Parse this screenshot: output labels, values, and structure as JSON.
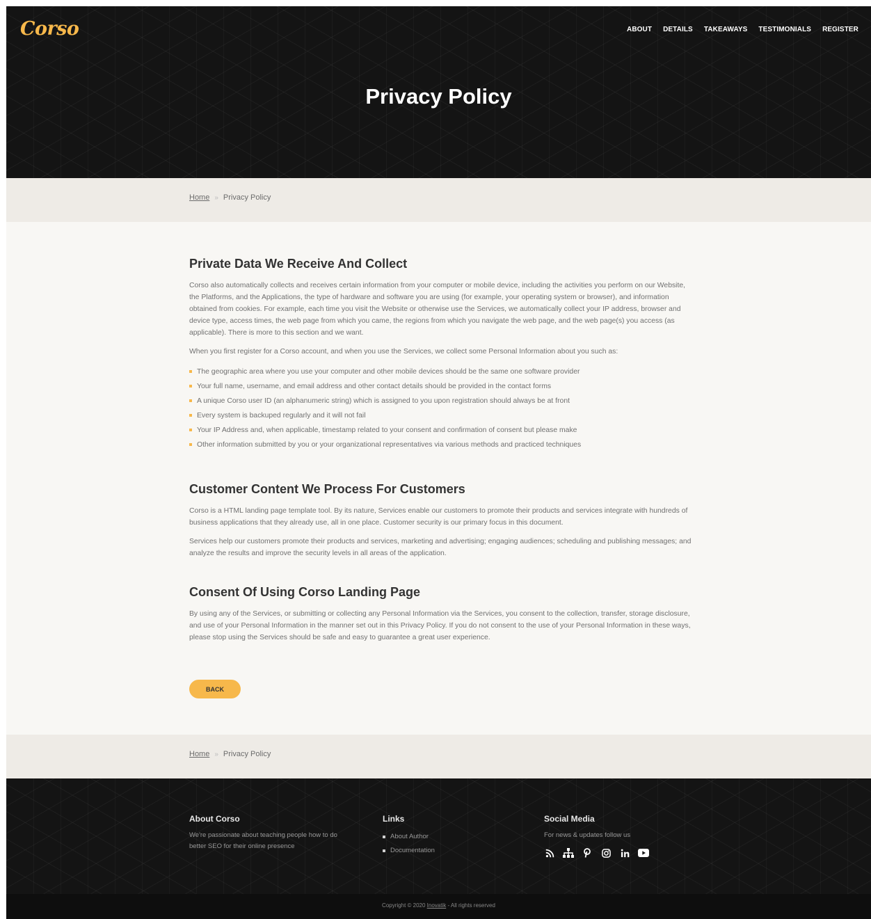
{
  "header": {
    "logo": "Corso",
    "nav": [
      "ABOUT",
      "DETAILS",
      "TAKEAWAYS",
      "TESTIMONIALS",
      "REGISTER"
    ],
    "title": "Privacy Policy"
  },
  "breadcrumb": {
    "home": "Home",
    "separator": "»",
    "current": "Privacy Policy"
  },
  "section1": {
    "heading": "Private Data We Receive And Collect",
    "para1": "Corso also automatically collects and receives certain information from your computer or mobile device, including the activities you perform on our Website, the Platforms, and the Applications, the type of hardware and software you are using (for example, your operating system or browser), and information obtained from cookies. For example, each time you visit the Website or otherwise use the Services, we automatically collect your IP address, browser and device type, access times, the web page from which you came, the regions from which you navigate the web page, and the web page(s) you access (as applicable). There is more to this section and we want.",
    "para2": "When you first register for a Corso account, and when you use the Services, we collect some Personal Information about you such as:",
    "bullets": [
      "The geographic area where you use your computer and other mobile devices should be the same one software provider",
      "Your full name, username, and email address and other contact details should be provided in the contact forms",
      "A unique Corso user ID (an alphanumeric string) which is assigned to you upon registration should always be at front",
      "Every system is backuped regularly and it will not fail",
      "Your IP Address and, when applicable, timestamp related to your consent and confirmation of consent but please make",
      "Other information submitted by you or your organizational representatives via various methods and practiced techniques"
    ]
  },
  "section2": {
    "heading": "Customer Content We Process For Customers",
    "para1": "Corso is a HTML landing page template tool. By its nature, Services enable our customers to promote their products and services integrate with hundreds of business applications that they already use, all in one place. Customer security is our primary focus in this document.",
    "para2": "Services help our customers promote their products and services, marketing and advertising; engaging audiences; scheduling and publishing messages; and analyze the results and improve the security levels in all areas of the application."
  },
  "section3": {
    "heading": "Consent Of Using Corso Landing Page",
    "para1": "By using any of the Services, or submitting or collecting any Personal Information via the Services, you consent to the collection, transfer, storage disclosure, and use of your Personal Information in the manner set out in this Privacy Policy. If you do not consent to the use of your Personal Information in these ways, please stop using the Services should be safe and easy to guarantee a great user experience."
  },
  "back_button": "BACK",
  "footer": {
    "about": {
      "title": "About Corso",
      "text": "We're passionate about teaching people how to do better SEO for their online presence"
    },
    "links": {
      "title": "Links",
      "items": [
        "About Author",
        "Documentation"
      ]
    },
    "social": {
      "title": "Social Media",
      "text": "For news & updates follow us",
      "icons": [
        "rss-icon",
        "sitemap-icon",
        "pinterest-icon",
        "instagram-icon",
        "linkedin-icon",
        "youtube-icon"
      ]
    },
    "copyright_prefix": "Copyright © 2020 ",
    "copyright_link": "Inovatik",
    "copyright_suffix": " - All rights reserved"
  },
  "colors": {
    "accent": "#f7b84b",
    "dark": "#141414",
    "page": "#f8f7f4",
    "crumb_bg": "#eeebe6"
  }
}
